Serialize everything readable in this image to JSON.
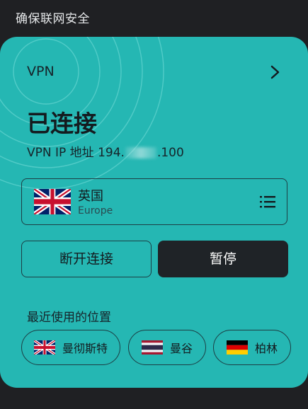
{
  "header": {
    "title": "确保联网安全"
  },
  "card": {
    "vpn_label": "VPN",
    "status": "已连接",
    "ip_prefix": "VPN IP 地址 194.",
    "ip_suffix": ".100",
    "location": {
      "name": "英国",
      "region": "Europe",
      "flag": "uk-flag-icon"
    },
    "buttons": {
      "disconnect": "断开连接",
      "pause": "暂停"
    },
    "recent": {
      "title": "最近使用的位置",
      "items": [
        {
          "label": "曼彻斯特",
          "flag": "uk-flag-icon"
        },
        {
          "label": "曼谷",
          "flag": "thailand-flag-icon"
        },
        {
          "label": "柏林",
          "flag": "germany-flag-icon"
        }
      ]
    }
  },
  "colors": {
    "accent": "#25b7b3",
    "background": "#1f2023",
    "button_dark": "#1f2327"
  }
}
